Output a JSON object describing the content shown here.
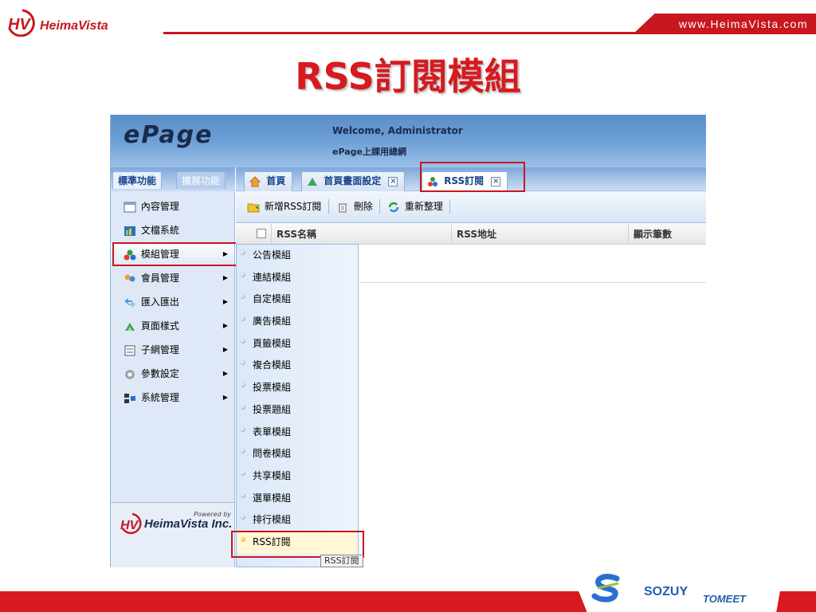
{
  "slide": {
    "brand": "HeimaVista",
    "url": "www.HeimaVista.com",
    "title": "RSS訂閱模組",
    "footer_logos": [
      "SOZUY",
      "TOMEET"
    ],
    "accent_color": "#d61a1f"
  },
  "app": {
    "logo": "ePage",
    "welcome": "Welcome, Administrator",
    "site_name": "ePage上課用總網",
    "panel_tabs": {
      "active": "標準功能",
      "inactive": "擴展功能"
    },
    "nav": [
      {
        "label": "內容管理",
        "icon": "content-icon",
        "submenu": false
      },
      {
        "label": "文檔系統",
        "icon": "document-icon",
        "submenu": false
      },
      {
        "label": "模組管理",
        "icon": "module-icon",
        "submenu": true
      },
      {
        "label": "會員管理",
        "icon": "members-icon",
        "submenu": true
      },
      {
        "label": "匯入匯出",
        "icon": "import-export-icon",
        "submenu": true
      },
      {
        "label": "頁面樣式",
        "icon": "page-style-icon",
        "submenu": true
      },
      {
        "label": "子網管理",
        "icon": "subsite-icon",
        "submenu": true
      },
      {
        "label": "參數設定",
        "icon": "settings-icon",
        "submenu": true
      },
      {
        "label": "系統管理",
        "icon": "system-icon",
        "submenu": true
      }
    ],
    "powered_by": "Powered by",
    "powered_company": "HeimaVista Inc.",
    "tabs": [
      {
        "label": "首頁",
        "icon": "home-icon",
        "closable": false
      },
      {
        "label": "首頁畫面設定",
        "icon": "layout-icon",
        "closable": true
      },
      {
        "label": "RSS訂閱",
        "icon": "module-icon",
        "closable": true
      }
    ],
    "toolbar": {
      "add": "新增RSS訂閱",
      "delete": "刪除",
      "reorder": "重新整理"
    },
    "grid_columns": [
      "RSS名稱",
      "RSS地址",
      "顯示筆數"
    ],
    "submenu": [
      "公告模組",
      "連結模組",
      "自定模組",
      "廣告模組",
      "頁籤模組",
      "複合模組",
      "投票模組",
      "投票題組",
      "表單模組",
      "問卷模組",
      "共享模組",
      "選單模組",
      "排行模組",
      "RSS訂閱"
    ],
    "tooltip": "RSS訂閱"
  }
}
